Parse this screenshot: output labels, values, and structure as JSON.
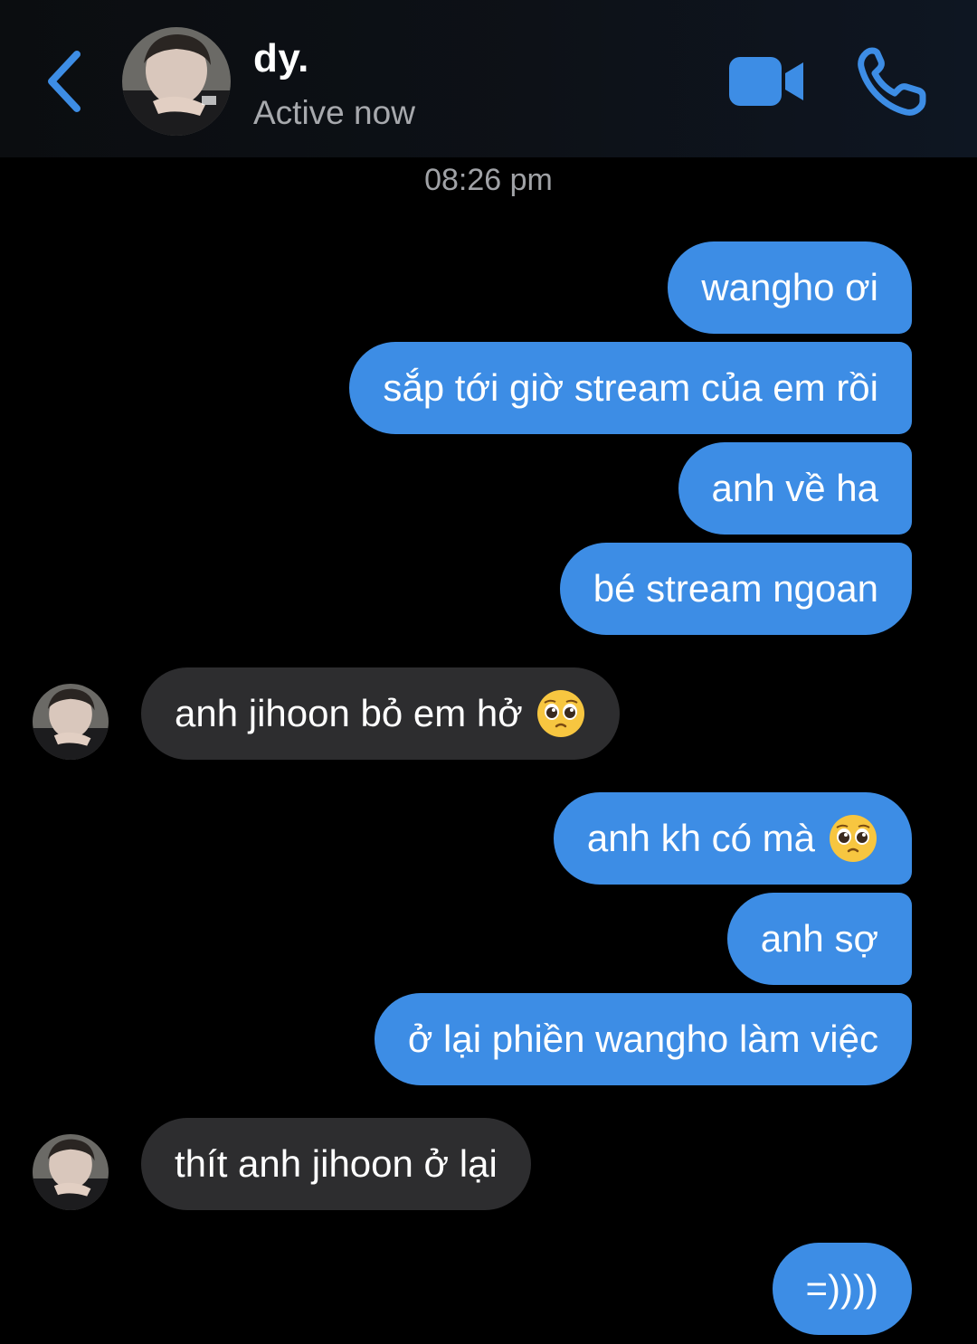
{
  "header": {
    "contact_name": "dy.",
    "status": "Active now"
  },
  "timestamp": "08:26 pm",
  "messages": [
    {
      "text": "wangho ơi",
      "direction": "sent"
    },
    {
      "text": "sắp tới giờ stream của em rồi",
      "direction": "sent"
    },
    {
      "text": "anh về ha",
      "direction": "sent"
    },
    {
      "text": "bé stream ngoan",
      "direction": "sent"
    },
    {
      "text": "anh jihoon bỏ em hở",
      "direction": "received",
      "emoji": "pleading-face-emoji"
    },
    {
      "text": "anh kh có mà",
      "direction": "sent",
      "emoji": "pleading-face-emoji"
    },
    {
      "text": "anh sợ",
      "direction": "sent"
    },
    {
      "text": "ở lại phiền wangho làm việc",
      "direction": "sent"
    },
    {
      "text": "thít anh jihoon ở lại",
      "direction": "received"
    },
    {
      "text": "=))))",
      "direction": "sent"
    }
  ],
  "colors": {
    "accent": "#3d8de5",
    "sent_bubble": "#3d8de5",
    "received_bubble": "#2d2d2f",
    "background": "#000000",
    "secondary_text": "#a7a9ad"
  },
  "icons": {
    "back": "chevron-left-icon",
    "video": "video-camera-icon",
    "call": "phone-icon"
  }
}
